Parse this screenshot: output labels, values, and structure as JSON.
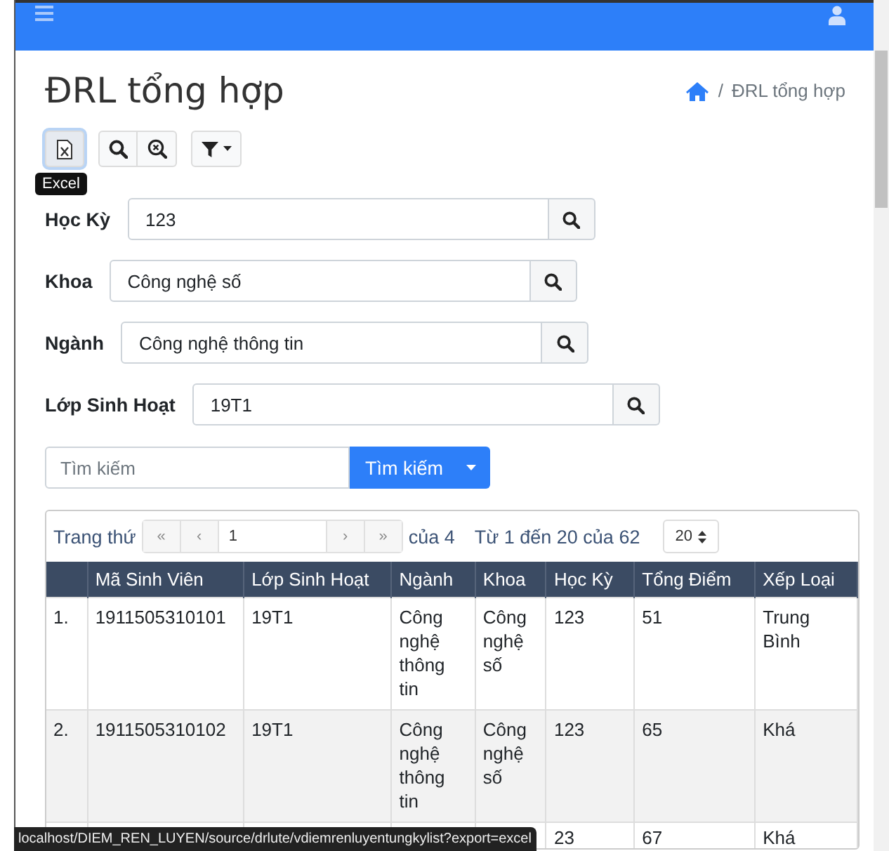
{
  "title": "ĐRL tổng hợp",
  "breadcrumb": {
    "separator": "/",
    "current": "ĐRL tổng hợp"
  },
  "toolbar": [
    {
      "kind": "excel",
      "focused": true,
      "attached": false,
      "tooltip": "Excel"
    },
    {
      "kind": "search",
      "focused": false,
      "attached": false
    },
    {
      "kind": "reset",
      "focused": false,
      "attached": true
    },
    {
      "kind": "filter",
      "focused": false,
      "attached": false
    }
  ],
  "filters": [
    {
      "label": "Học Kỳ",
      "value": "123"
    },
    {
      "label": "Khoa",
      "value": "Công nghệ số"
    },
    {
      "label": "Ngành",
      "value": "Công nghệ thông tin"
    },
    {
      "label": "Lớp Sinh Hoạt",
      "value": "19T1"
    }
  ],
  "search": {
    "placeholder": "Tìm kiếm",
    "button": "Tìm kiếm"
  },
  "pager": {
    "label": "Trang thứ",
    "first": "«",
    "prev": "‹",
    "page": "1",
    "next": "›",
    "last": "»",
    "page_count": "của 4",
    "range": "Từ 1 đến 20 của 62",
    "page_size": "20"
  },
  "table": {
    "columns": [
      "Mã Sinh Viên",
      "Lớp Sinh Hoạt",
      "Ngành",
      "Khoa",
      "Học Kỳ",
      "Tổng Điểm",
      "Xếp Loại"
    ],
    "rows": [
      {
        "index": "1.",
        "cells": [
          "1911505310101",
          "19T1",
          "Công nghệ thông tin",
          "Công nghệ số",
          "123",
          "51",
          "Trung Bình"
        ]
      },
      {
        "index": "2.",
        "cells": [
          "1911505310102",
          "19T1",
          "Công nghệ thông tin",
          "Công nghệ số",
          "123",
          "65",
          "Khá"
        ]
      },
      {
        "index": null,
        "cells": [
          null,
          null,
          null,
          null,
          "23",
          "67",
          "Khá"
        ]
      }
    ]
  },
  "status_bar": "localhost/DIEM_REN_LUYEN/source/drlute/vdiemrenluyentungkylist?export=excel"
}
